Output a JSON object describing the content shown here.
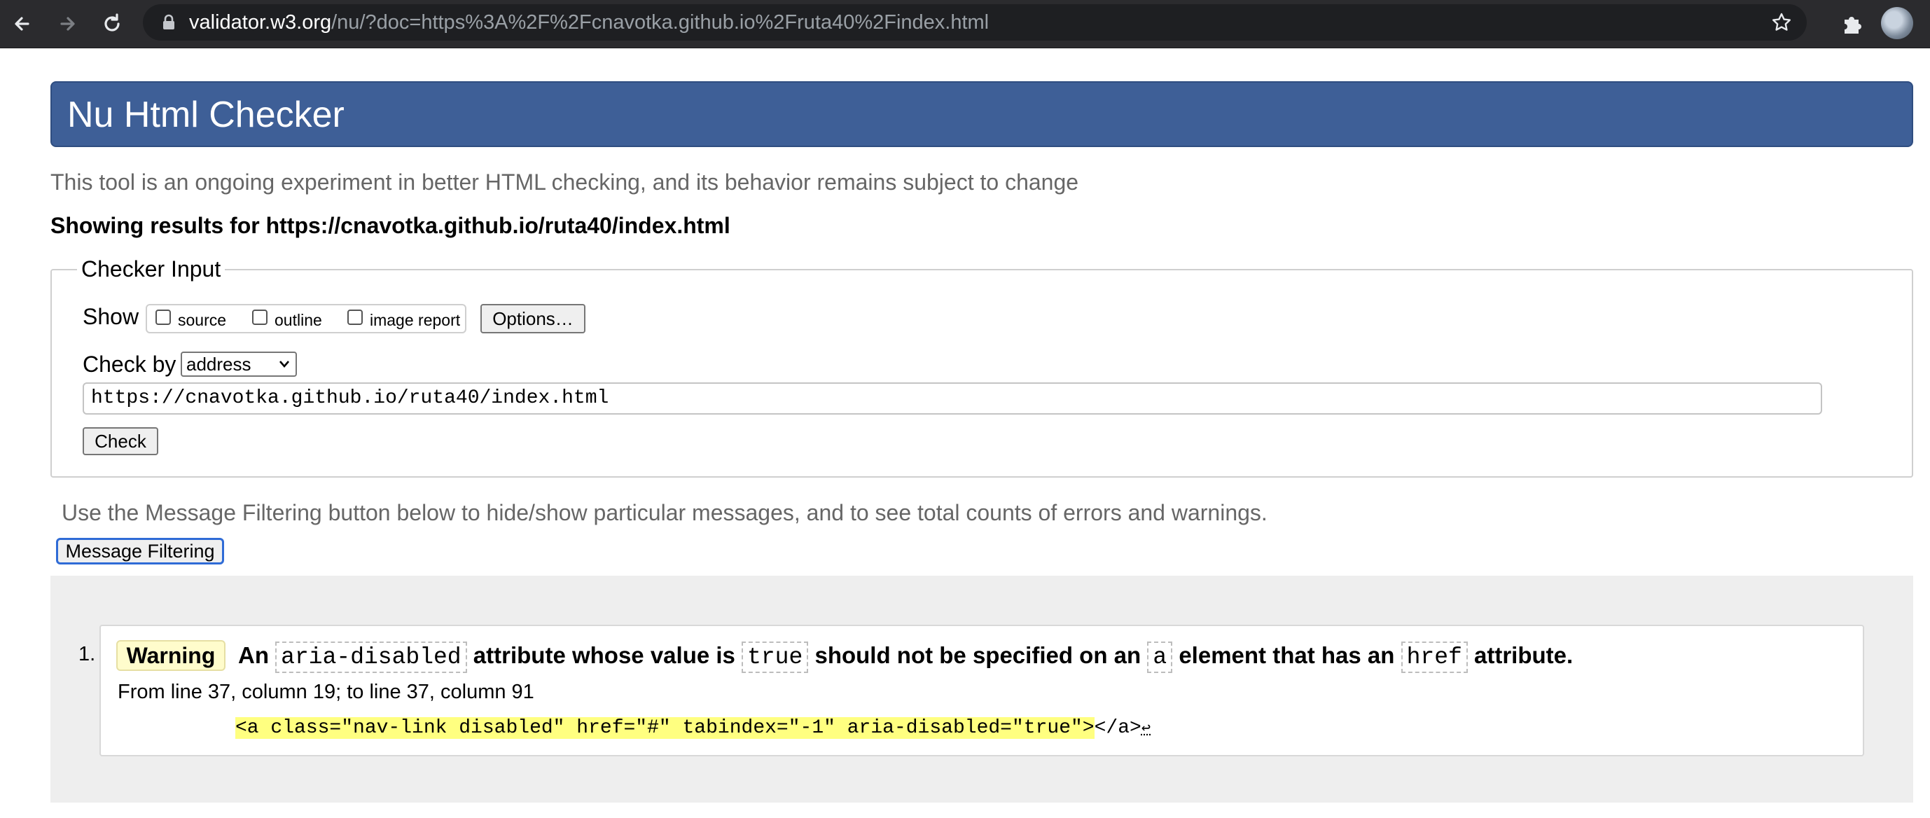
{
  "browser": {
    "url_host": "validator.w3.org",
    "url_rest": "/nu/?doc=https%3A%2F%2Fcnavotka.github.io%2Fruta40%2Findex.html"
  },
  "page": {
    "title": "Nu Html Checker",
    "tagline": "This tool is an ongoing experiment in better HTML checking, and its behavior remains subject to change",
    "showing_results": "Showing results for https://cnavotka.github.io/ruta40/index.html"
  },
  "checker": {
    "legend": "Checker Input",
    "show_label": "Show",
    "options": [
      {
        "label": "source",
        "checked": false
      },
      {
        "label": "outline",
        "checked": false
      },
      {
        "label": "image report",
        "checked": false
      }
    ],
    "options_button": "Options…",
    "check_by_label": "Check by",
    "check_by_value": "address",
    "address_value": "https://cnavotka.github.io/ruta40/index.html",
    "check_button": "Check"
  },
  "filtering": {
    "note": "Use the Message Filtering button below to hide/show particular messages, and to see total counts of errors and warnings.",
    "button": "Message Filtering"
  },
  "results": [
    {
      "number": "1.",
      "type": "Warning",
      "message_parts": {
        "p1": "An",
        "c1": "aria-disabled",
        "p2": "attribute whose value is",
        "c2": "true",
        "p3": "should not be specified on an",
        "c3": "a",
        "p4": "element that has an",
        "c4": "href",
        "p5": "attribute."
      },
      "location": "From line 37, column 19; to line 37, column 91",
      "extract_highlight": "<a class=\"nav-link disabled\" href=\"#\" tabindex=\"-1\" aria-disabled=\"true\">",
      "extract_rest": "</a>",
      "extract_return": "↩"
    }
  ],
  "colors": {
    "banner": "#3e5f97",
    "warning_badge": "#fffccc",
    "highlight": "#ffff80",
    "focus": "#2f6bd6"
  }
}
